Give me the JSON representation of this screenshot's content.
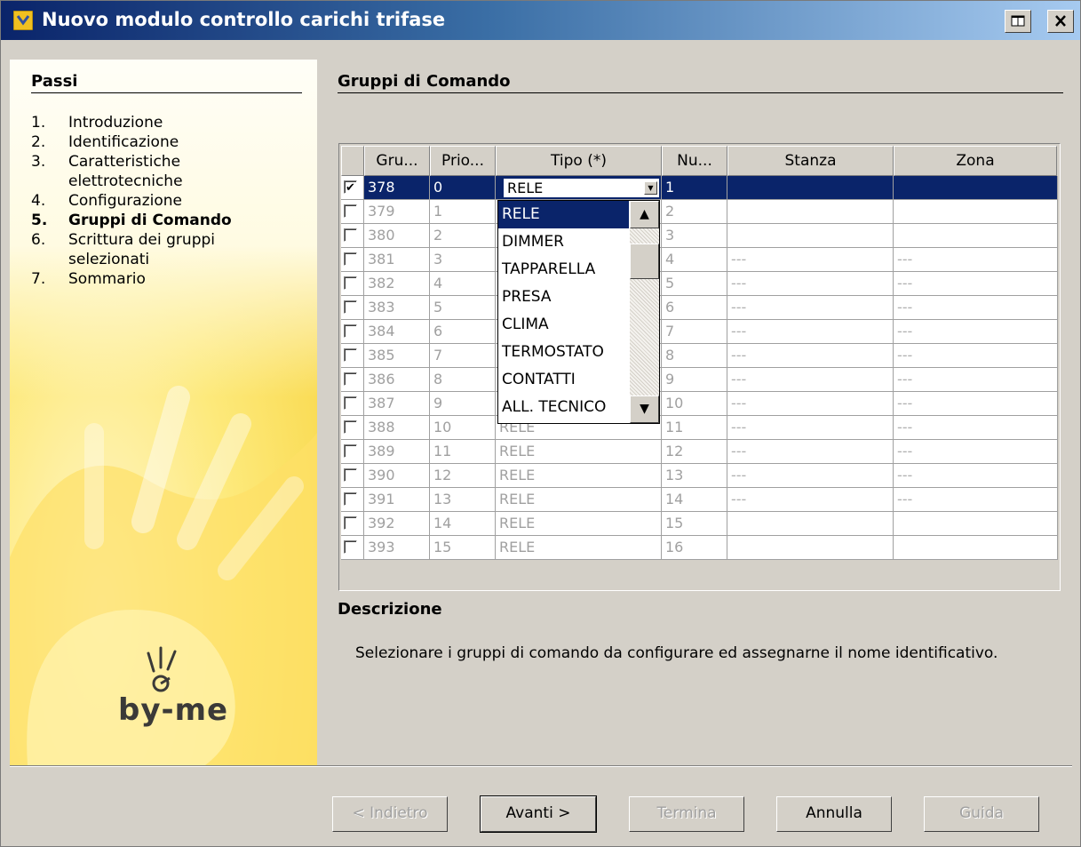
{
  "window": {
    "title": "Nuovo modulo controllo carichi trifase"
  },
  "sidebar": {
    "heading": "Passi",
    "steps": [
      {
        "num": "1.",
        "label": "Introduzione"
      },
      {
        "num": "2.",
        "label": "Identificazione"
      },
      {
        "num": "3.",
        "label": "Caratteristiche elettrotecniche"
      },
      {
        "num": "4.",
        "label": "Configurazione"
      },
      {
        "num": "5.",
        "label": "Gruppi di Comando"
      },
      {
        "num": "6.",
        "label": "Scrittura dei gruppi selezionati"
      },
      {
        "num": "7.",
        "label": "Sommario"
      }
    ],
    "logo_text": "by-me"
  },
  "main": {
    "heading": "Gruppi di Comando",
    "grid": {
      "columns": [
        "",
        "Gru...",
        "Prio...",
        "Tipo (*)",
        "Nu...",
        "Stanza",
        "Zona"
      ],
      "rows": [
        {
          "checked": true,
          "gruppo": "378",
          "prio": "0",
          "tipo": "RELE",
          "num": "1",
          "stanza": "",
          "zona": ""
        },
        {
          "checked": false,
          "gruppo": "379",
          "prio": "1",
          "tipo": "",
          "num": "2",
          "stanza": "",
          "zona": ""
        },
        {
          "checked": false,
          "gruppo": "380",
          "prio": "2",
          "tipo": "",
          "num": "3",
          "stanza": "",
          "zona": ""
        },
        {
          "checked": false,
          "gruppo": "381",
          "prio": "3",
          "tipo": "",
          "num": "4",
          "stanza": "---",
          "zona": "---"
        },
        {
          "checked": false,
          "gruppo": "382",
          "prio": "4",
          "tipo": "",
          "num": "5",
          "stanza": "---",
          "zona": "---"
        },
        {
          "checked": false,
          "gruppo": "383",
          "prio": "5",
          "tipo": "",
          "num": "6",
          "stanza": "---",
          "zona": "---"
        },
        {
          "checked": false,
          "gruppo": "384",
          "prio": "6",
          "tipo": "",
          "num": "7",
          "stanza": "---",
          "zona": "---"
        },
        {
          "checked": false,
          "gruppo": "385",
          "prio": "7",
          "tipo": "",
          "num": "8",
          "stanza": "---",
          "zona": "---"
        },
        {
          "checked": false,
          "gruppo": "386",
          "prio": "8",
          "tipo": "",
          "num": "9",
          "stanza": "---",
          "zona": "---"
        },
        {
          "checked": false,
          "gruppo": "387",
          "prio": "9",
          "tipo": "",
          "num": "10",
          "stanza": "---",
          "zona": "---"
        },
        {
          "checked": false,
          "gruppo": "388",
          "prio": "10",
          "tipo": "RELE",
          "num": "11",
          "stanza": "---",
          "zona": "---"
        },
        {
          "checked": false,
          "gruppo": "389",
          "prio": "11",
          "tipo": "RELE",
          "num": "12",
          "stanza": "---",
          "zona": "---"
        },
        {
          "checked": false,
          "gruppo": "390",
          "prio": "12",
          "tipo": "RELE",
          "num": "13",
          "stanza": "---",
          "zona": "---"
        },
        {
          "checked": false,
          "gruppo": "391",
          "prio": "13",
          "tipo": "RELE",
          "num": "14",
          "stanza": "---",
          "zona": "---"
        },
        {
          "checked": false,
          "gruppo": "392",
          "prio": "14",
          "tipo": "RELE",
          "num": "15",
          "stanza": "",
          "zona": ""
        },
        {
          "checked": false,
          "gruppo": "393",
          "prio": "15",
          "tipo": "RELE",
          "num": "16",
          "stanza": "",
          "zona": ""
        }
      ]
    },
    "dropdown": {
      "selected": "RELE",
      "options": [
        "RELE",
        "DIMMER",
        "TAPPARELLA",
        "PRESA",
        "CLIMA",
        "TERMOSTATO",
        "CONTATTI",
        "ALL. TECNICO"
      ]
    },
    "description": {
      "heading": "Descrizione",
      "text": "Selezionare i gruppi di comando da configurare ed assegnarne il nome identificativo."
    }
  },
  "buttons": {
    "back": "< Indietro",
    "next": "Avanti >",
    "finish": "Termina",
    "cancel": "Annulla",
    "help": "Guida"
  },
  "colors": {
    "selection": "#0a246a",
    "sidebar_yellow": "#f7d23a",
    "dialog_bg": "#d4d0c8"
  }
}
